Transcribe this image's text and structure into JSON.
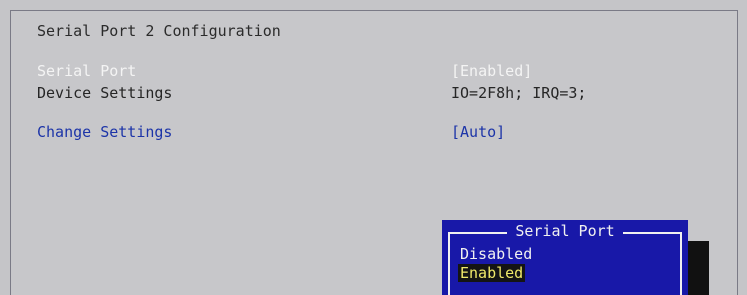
{
  "screen": {
    "title": "Serial Port 2 Configuration"
  },
  "settings": [
    {
      "label": "Serial Port",
      "value": "[Enabled]"
    },
    {
      "label": "Device Settings",
      "value": "IO=2F8h; IRQ=3;"
    },
    {
      "label": "Change Settings",
      "value": "[Auto]"
    }
  ],
  "popup": {
    "title": "Serial Port",
    "options": [
      "Disabled",
      "Enabled"
    ],
    "selected": "Enabled"
  },
  "colors": {
    "background": "#c5c5c8",
    "highlight_text": "#f4f4f4",
    "link_text": "#1c34a8",
    "popup_bg": "#1818a8",
    "selected_text": "#f0e96a"
  }
}
